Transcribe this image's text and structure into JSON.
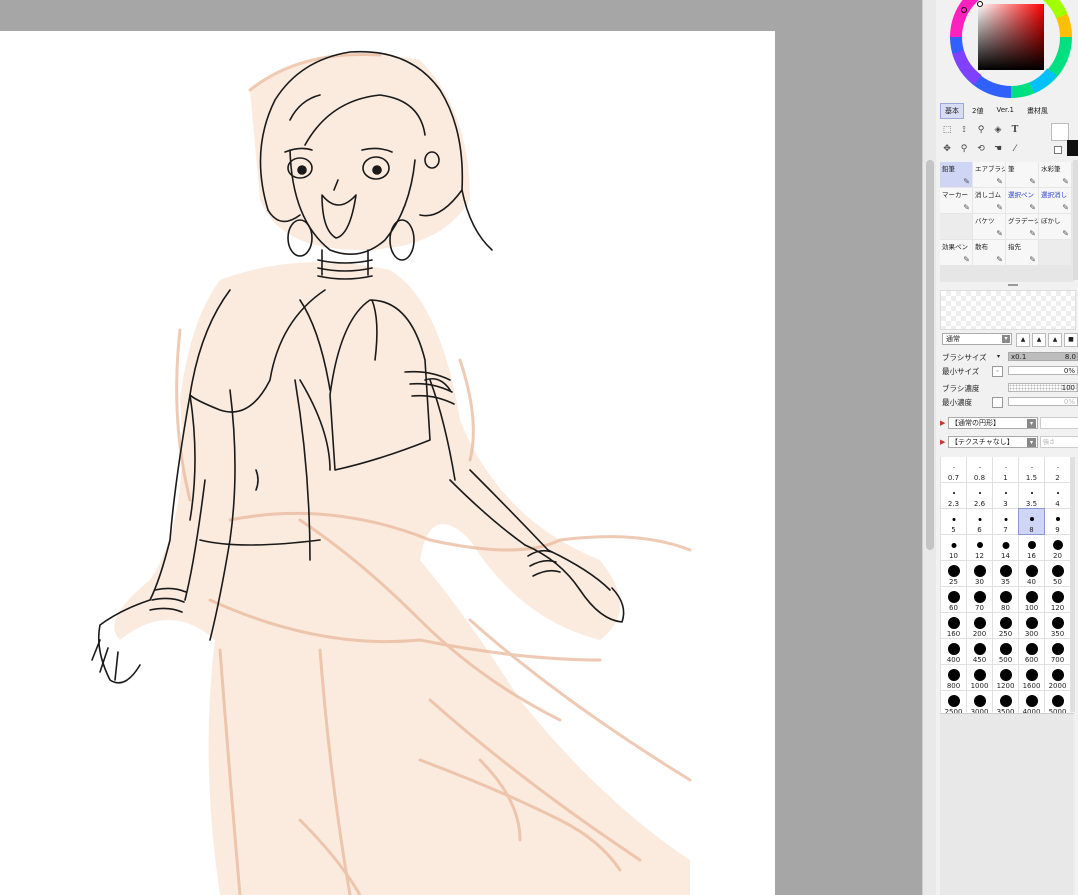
{
  "color_panel": {
    "tabs": [
      {
        "label": "基本",
        "active": true
      },
      {
        "label": "2値",
        "active": false
      },
      {
        "label": "Ver.1",
        "active": false
      },
      {
        "label": "畫材風",
        "active": false
      }
    ],
    "foreground_color": "#ffffff",
    "background_color": "#111111"
  },
  "tools": {
    "text_tool_label": "T"
  },
  "brushes": [
    {
      "label": "鉛筆",
      "selected": true,
      "icon": "pencil-icon"
    },
    {
      "label": "エアブラシ",
      "icon": "airbrush-icon"
    },
    {
      "label": "筆",
      "icon": "brush-icon"
    },
    {
      "label": "水彩筆",
      "icon": "watercolor-icon"
    },
    {
      "label": "マーカー",
      "icon": "marker-icon"
    },
    {
      "label": "消しゴム",
      "icon": "eraser-icon"
    },
    {
      "label": "選択ペン",
      "blue": true,
      "icon": "select-pen-icon"
    },
    {
      "label": "選択消し",
      "blue": true,
      "icon": "select-erase-icon"
    },
    {
      "label": "",
      "empty": true
    },
    {
      "label": "バケツ",
      "icon": "bucket-icon"
    },
    {
      "label": "グラデーション",
      "icon": "gradient-icon"
    },
    {
      "label": "ぼかし",
      "icon": "blur-icon"
    },
    {
      "label": "効果ペン",
      "icon": "effect-pen-icon"
    },
    {
      "label": "散布",
      "icon": "scatter-icon"
    },
    {
      "label": "指先",
      "icon": "finger-icon"
    },
    {
      "label": "",
      "empty": true
    }
  ],
  "blend_mode": "通常",
  "brush_props": {
    "brush_size_label": "ブラシサイズ",
    "brush_size_multiplier": "x0.1",
    "brush_size_value": "8.0",
    "min_size_label": "最小サイズ",
    "min_size_value": "0%",
    "density_label": "ブラシ濃度",
    "density_value": "100",
    "min_density_label": "最小濃度",
    "min_density_value": "0%"
  },
  "shape_option": "【通常の円形】",
  "texture_option": "【テクスチャなし】",
  "texture_extra": "強さ",
  "size_presets": [
    {
      "label": "0.7",
      "d": 1
    },
    {
      "label": "0.8",
      "d": 1
    },
    {
      "label": "1",
      "d": 1
    },
    {
      "label": "1.5",
      "d": 1
    },
    {
      "label": "2",
      "d": 1
    },
    {
      "label": "2.3",
      "d": 2
    },
    {
      "label": "2.6",
      "d": 2
    },
    {
      "label": "3",
      "d": 2
    },
    {
      "label": "3.5",
      "d": 2
    },
    {
      "label": "4",
      "d": 2
    },
    {
      "label": "5",
      "d": 3
    },
    {
      "label": "6",
      "d": 3
    },
    {
      "label": "7",
      "d": 3
    },
    {
      "label": "8",
      "d": 4,
      "selected": true
    },
    {
      "label": "9",
      "d": 4
    },
    {
      "label": "10",
      "d": 5
    },
    {
      "label": "12",
      "d": 6
    },
    {
      "label": "14",
      "d": 7
    },
    {
      "label": "16",
      "d": 8
    },
    {
      "label": "20",
      "d": 10
    },
    {
      "label": "25",
      "d": 12
    },
    {
      "label": "30",
      "d": 12
    },
    {
      "label": "35",
      "d": 12
    },
    {
      "label": "40",
      "d": 12
    },
    {
      "label": "50",
      "d": 12
    },
    {
      "label": "60",
      "d": 12
    },
    {
      "label": "70",
      "d": 12
    },
    {
      "label": "80",
      "d": 12
    },
    {
      "label": "100",
      "d": 12
    },
    {
      "label": "120",
      "d": 12
    },
    {
      "label": "160",
      "d": 12
    },
    {
      "label": "200",
      "d": 12
    },
    {
      "label": "250",
      "d": 12
    },
    {
      "label": "300",
      "d": 12
    },
    {
      "label": "350",
      "d": 12
    },
    {
      "label": "400",
      "d": 12
    },
    {
      "label": "450",
      "d": 12
    },
    {
      "label": "500",
      "d": 12
    },
    {
      "label": "600",
      "d": 12
    },
    {
      "label": "700",
      "d": 12
    },
    {
      "label": "800",
      "d": 12
    },
    {
      "label": "1000",
      "d": 12
    },
    {
      "label": "1200",
      "d": 12
    },
    {
      "label": "1600",
      "d": 12
    },
    {
      "label": "2000",
      "d": 12
    },
    {
      "label": "2500",
      "d": 12
    },
    {
      "label": "3000",
      "d": 12
    },
    {
      "label": "3500",
      "d": 12
    },
    {
      "label": "4000",
      "d": 12
    },
    {
      "label": "5000",
      "d": 12
    }
  ]
}
